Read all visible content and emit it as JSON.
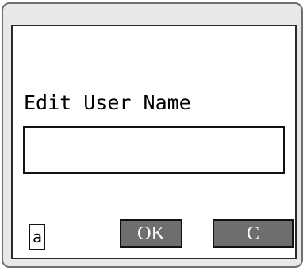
{
  "dialog": {
    "title": "Edit User Name",
    "name_input_value": "",
    "input_mode": "a",
    "ok_label": "OK",
    "cancel_label": "C"
  },
  "colors": {
    "device_bg": "#e8e8e8",
    "screen_bg": "#ffffff",
    "button_bg": "#6e6e6e",
    "button_text": "#ffffff"
  }
}
